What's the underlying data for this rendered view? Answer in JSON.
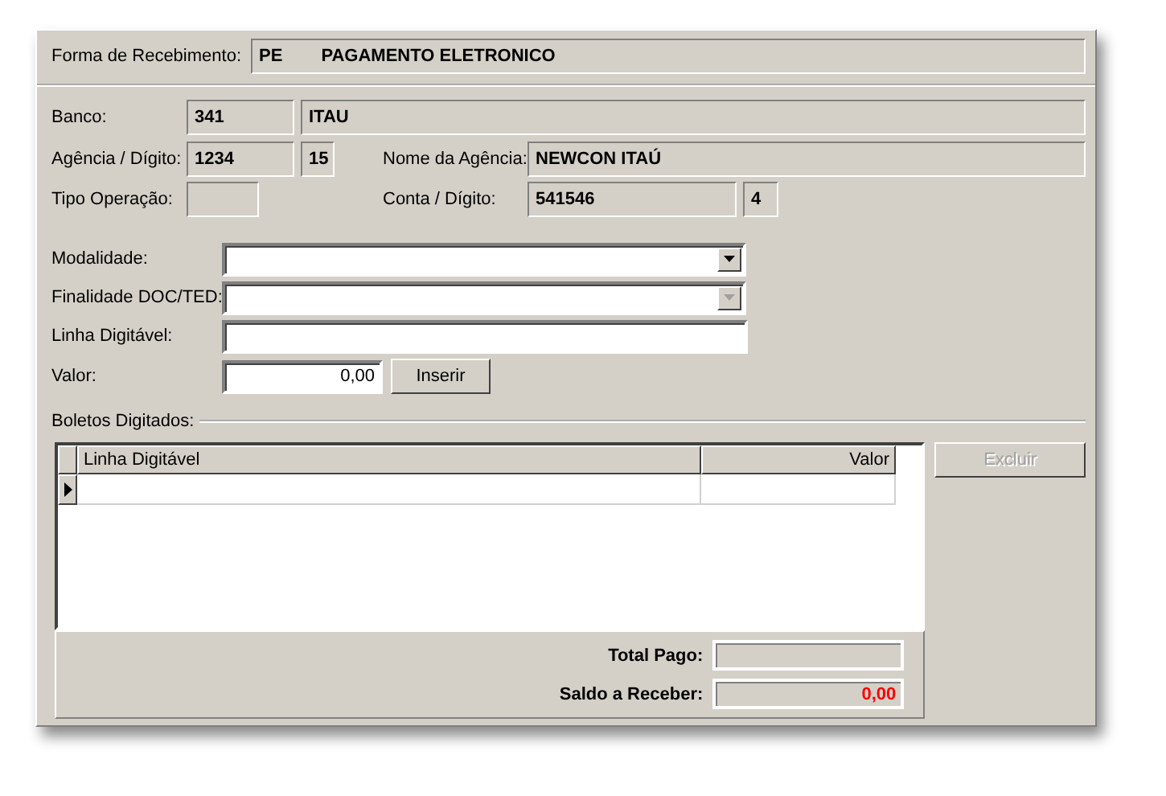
{
  "forma_recebimento": {
    "label": "Forma de Recebimento:",
    "code": "PE",
    "name": "PAGAMENTO ELETRONICO"
  },
  "banco": {
    "label": "Banco:",
    "code": "341",
    "name": "ITAU"
  },
  "agencia": {
    "label": "Agência / Dígito:",
    "number": "1234",
    "digit": "15",
    "name_label": "Nome da Agência:",
    "name": "NEWCON ITAÚ"
  },
  "tipo_operacao": {
    "label": "Tipo Operação:",
    "account_label": "Conta / Dígito:",
    "account": "541546",
    "account_digit": "4"
  },
  "modalidade": {
    "label": "Modalidade:",
    "disabled": false
  },
  "finalidade": {
    "label": "Finalidade DOC/TED:",
    "disabled": true
  },
  "linha_digitavel": {
    "label": "Linha Digitável:"
  },
  "valor": {
    "label": "Valor:",
    "value": "0,00"
  },
  "insert_button": {
    "label": "Inserir",
    "disabled": false
  },
  "boletos": {
    "label": "Boletos Digitados:",
    "columns": [
      "Linha Digitável",
      "Valor"
    ],
    "rows": [
      {
        "selected": true
      }
    ]
  },
  "delete_button": {
    "label": "Excluir",
    "disabled": true
  },
  "totals": {
    "total_label": "Total Pago:",
    "balance_label": "Saldo a Receber:",
    "balance": "0,00"
  }
}
